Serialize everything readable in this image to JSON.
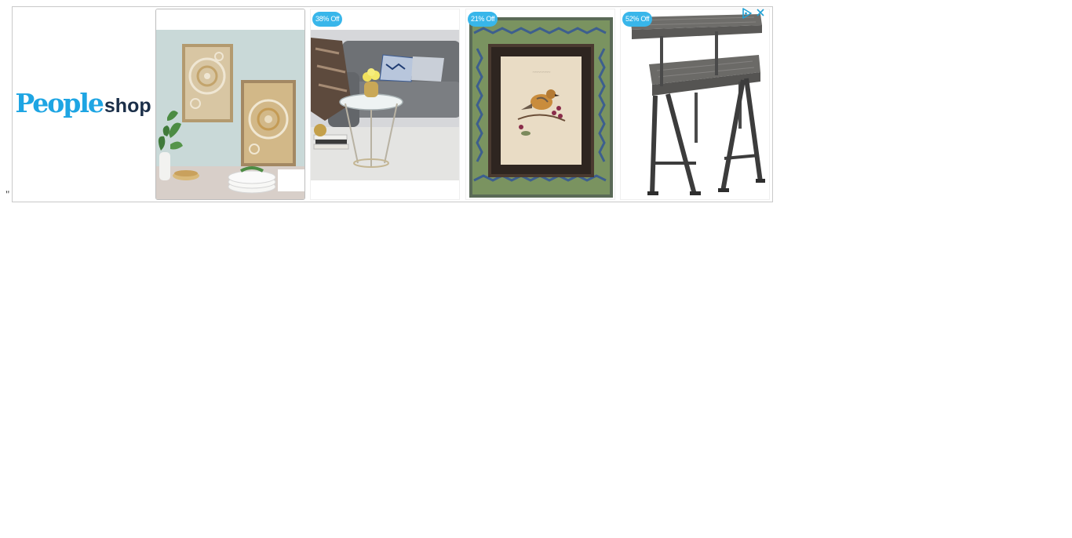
{
  "stray_text": "\"",
  "ad": {
    "brand": {
      "part1": "People",
      "part2": "shop",
      "part1_color": "#1ea5e3",
      "part2_color": "#1b2f49"
    },
    "accent_color": "#38b6ea",
    "adchoices_icon": "adchoices-triangle-icon",
    "close_icon": "close-x-icon",
    "products": [
      {
        "name": "wall-art-panels",
        "badge": ""
      },
      {
        "name": "glass-side-table",
        "badge": "38% Off"
      },
      {
        "name": "bird-picture-frame",
        "badge": "21% Off"
      },
      {
        "name": "two-tier-bench-table",
        "badge": "52% Off"
      }
    ]
  }
}
